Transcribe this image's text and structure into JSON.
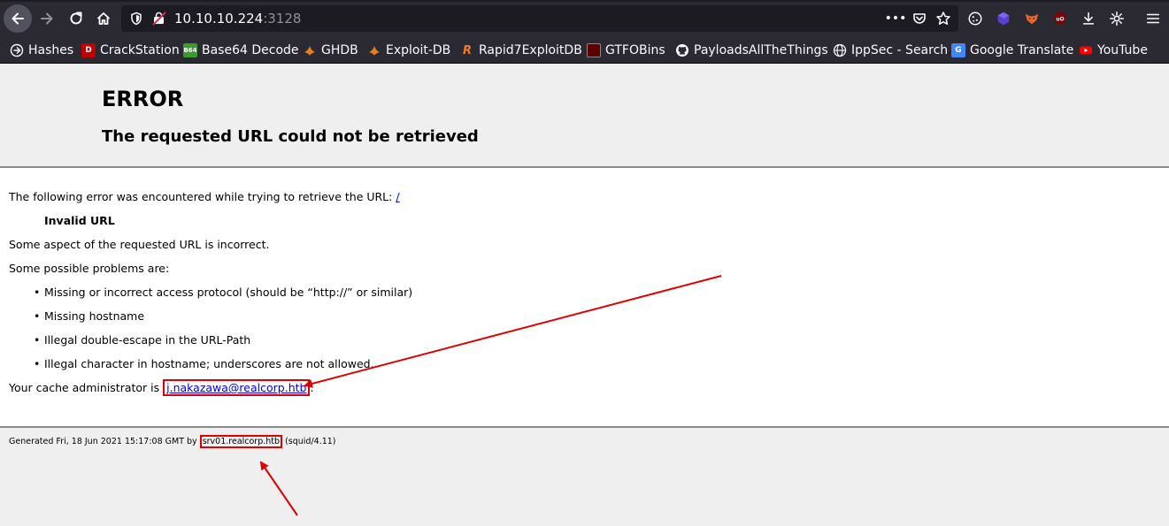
{
  "browser": {
    "url_host": "10.10.10.224",
    "url_port": ":3128",
    "icons": {
      "back": "back-arrow-icon",
      "forward": "forward-arrow-icon",
      "reload": "reload-icon",
      "home": "home-icon",
      "page_actions": "ellipsis-icon",
      "pocket": "pocket-icon",
      "bookmark": "star-icon",
      "downloads": "download-icon",
      "settings": "gear-icon",
      "menu": "hamburger-menu-icon"
    }
  },
  "bookmarks": [
    {
      "label": "Hashes",
      "icon": "globe-icon"
    },
    {
      "label": "CrackStation",
      "icon": "crackstation-icon"
    },
    {
      "label": "Base64 Decode",
      "icon": "b64-icon"
    },
    {
      "label": "GHDB",
      "icon": "exploit-db-icon"
    },
    {
      "label": "Exploit-DB",
      "icon": "exploit-db-icon"
    },
    {
      "label": "Rapid7ExploitDB",
      "icon": "rapid7-icon"
    },
    {
      "label": "GTFOBins",
      "icon": "gtfobins-icon"
    },
    {
      "label": "PayloadsAllTheThings",
      "icon": "github-icon"
    },
    {
      "label": "IppSec - Search",
      "icon": "globe-icon"
    },
    {
      "label": "Google Translate",
      "icon": "google-translate-icon"
    },
    {
      "label": "YouTube",
      "icon": "youtube-icon"
    }
  ],
  "page": {
    "title": "ERROR",
    "subtitle": "The requested URL could not be retrieved",
    "intro": "The following error was encountered while trying to retrieve the URL: ",
    "intro_link": "/",
    "error_name": "Invalid URL",
    "aspect": "Some aspect of the requested URL is incorrect.",
    "problems_heading": "Some possible problems are:",
    "problems": [
      "Missing or incorrect access protocol (should be “http://” or similar)",
      "Missing hostname",
      "Illegal double-escape in the URL-Path",
      "Illegal character in hostname; underscores are not allowed."
    ],
    "admin_prefix": "Your cache administrator is ",
    "admin_email": "j.nakazawa@realcorp.htb",
    "admin_suffix": ".",
    "footer_prefix": "Generated Fri, 18 Jun 2021 15:17:08 GMT by ",
    "footer_host": "srv01.realcorp.htb",
    "footer_suffix": " (squid/4.11)"
  },
  "colors": {
    "annotation": "#e00000",
    "link": "#0000ee",
    "chrome": "#2b2a33"
  }
}
